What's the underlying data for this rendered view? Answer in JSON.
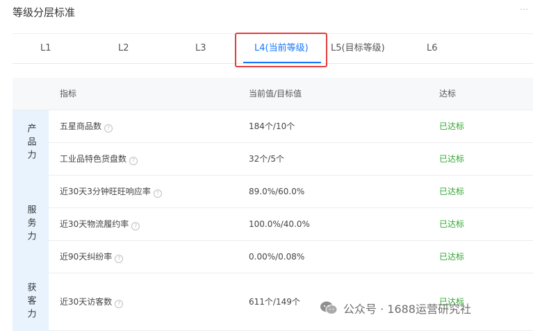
{
  "page": {
    "title": "等级分层标准"
  },
  "tabs": [
    {
      "label": "L1"
    },
    {
      "label": "L2"
    },
    {
      "label": "L3"
    },
    {
      "label": "L4(当前等级)"
    },
    {
      "label": "L5(目标等级)"
    },
    {
      "label": "L6"
    }
  ],
  "table": {
    "headers": {
      "metric": "指标",
      "value": "当前值/目标值",
      "status": "达标"
    },
    "groups": [
      {
        "label": "产品力",
        "rows": [
          {
            "metric": "五星商品数",
            "value": "184个/10个",
            "status": "已达标"
          },
          {
            "metric": "工业品特色货盘数",
            "value": "32个/5个",
            "status": "已达标"
          }
        ]
      },
      {
        "label": "服务力",
        "rows": [
          {
            "metric": "近30天3分钟旺旺响应率",
            "value": "89.0%/60.0%",
            "status": "已达标"
          },
          {
            "metric": "近30天物流履约率",
            "value": "100.0%/40.0%",
            "status": "已达标"
          },
          {
            "metric": "近90天纠纷率",
            "value": "0.00%/0.08%",
            "status": "已达标"
          }
        ]
      },
      {
        "label": "获客力",
        "rows": [
          {
            "metric": "近30天访客数",
            "value": "611个/149个",
            "status": "已达标"
          }
        ]
      }
    ]
  },
  "watermark": {
    "text": "公众号 · 1688运营研究社"
  },
  "colors": {
    "accent": "#1677ff",
    "success": "#2fa82f",
    "highlight_box": "#e33b3b",
    "group_bg": "#e8f3fe"
  }
}
